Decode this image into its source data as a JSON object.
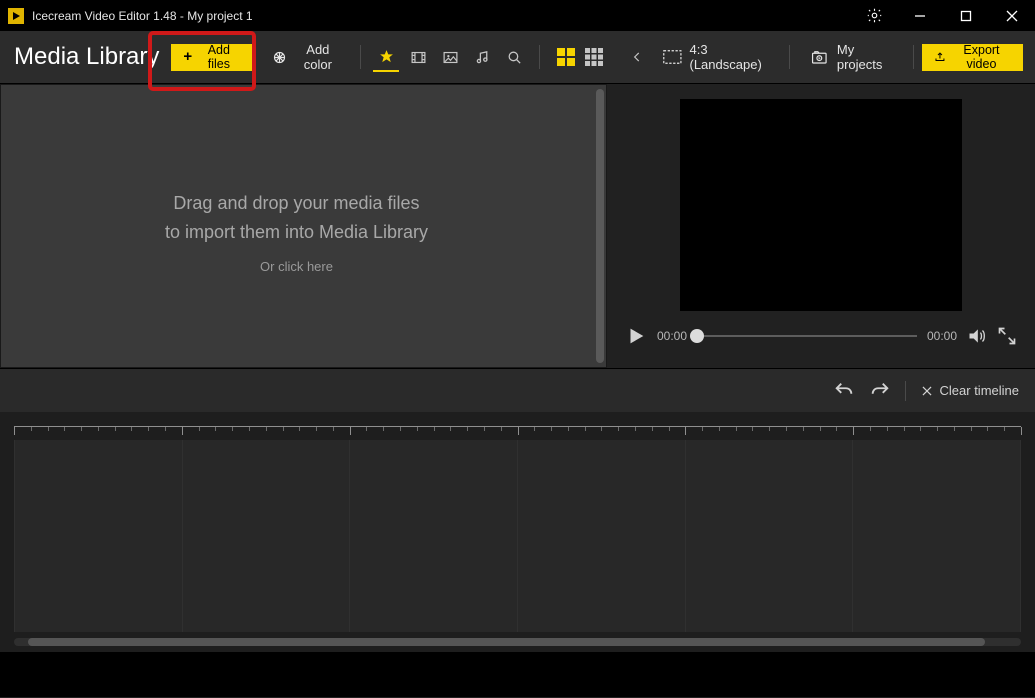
{
  "titlebar": {
    "app_name": "Icecream Video Editor 1.48",
    "project_separator": "  -  ",
    "project_name": "My project 1"
  },
  "toolbar": {
    "media_library_title": "Media Library",
    "add_files_label": "Add files",
    "add_color_label": "Add color",
    "aspect_label": "4:3 (Landscape)",
    "my_projects_label": "My projects",
    "export_label": "Export video"
  },
  "library": {
    "drop_line1": "Drag and drop your media files",
    "drop_line2": "to import them into Media Library",
    "drop_click": "Or click here"
  },
  "preview": {
    "time_current": "00:00",
    "time_total": "00:00"
  },
  "timeline_header": {
    "clear_label": "Clear timeline"
  },
  "colors": {
    "accent": "#f6d400"
  }
}
